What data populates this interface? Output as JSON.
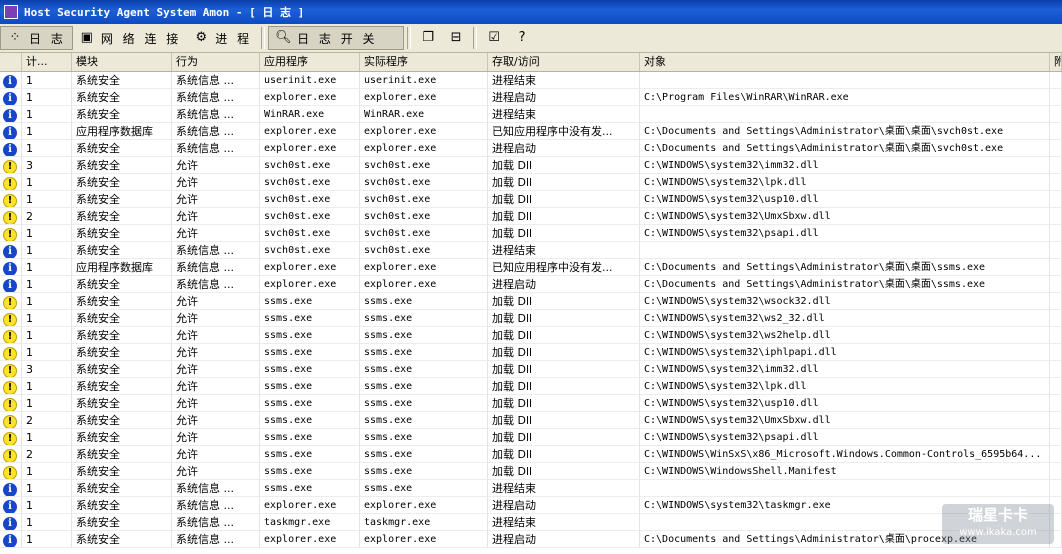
{
  "window": {
    "title": "Host Security Agent System Amon - [ 日 志 ]"
  },
  "toolbar": {
    "log_label": "日 志",
    "network_label": "网 络 连 接",
    "process_label": "进 程",
    "log_switch_label": "日 志 开 关"
  },
  "columns": [
    "计...",
    "模块",
    "行为",
    "应用程序",
    "实际程序",
    "存取/访问",
    "对象",
    "附"
  ],
  "rows": [
    {
      "icon": "info",
      "count": "1",
      "module": "系统安全",
      "action": "系统信息 ...",
      "app": "userinit.exe",
      "real": "userinit.exe",
      "access": "进程结束",
      "object": ""
    },
    {
      "icon": "info",
      "count": "1",
      "module": "系统安全",
      "action": "系统信息 ...",
      "app": "explorer.exe",
      "real": "explorer.exe",
      "access": "进程启动",
      "object": "C:\\Program Files\\WinRAR\\WinRAR.exe"
    },
    {
      "icon": "info",
      "count": "1",
      "module": "系统安全",
      "action": "系统信息 ...",
      "app": "WinRAR.exe",
      "real": "WinRAR.exe",
      "access": "进程结束",
      "object": ""
    },
    {
      "icon": "info",
      "count": "1",
      "module": "应用程序数据库",
      "action": "系统信息 ...",
      "app": "explorer.exe",
      "real": "explorer.exe",
      "access": "已知应用程序中没有发...",
      "object": "C:\\Documents and Settings\\Administrator\\桌面\\桌面\\svch0st.exe"
    },
    {
      "icon": "info",
      "count": "1",
      "module": "系统安全",
      "action": "系统信息 ...",
      "app": "explorer.exe",
      "real": "explorer.exe",
      "access": "进程启动",
      "object": "C:\\Documents and Settings\\Administrator\\桌面\\桌面\\svch0st.exe"
    },
    {
      "icon": "warn",
      "count": "3",
      "module": "系统安全",
      "action": "允许",
      "app": "svch0st.exe",
      "real": "svch0st.exe",
      "access": "加载 Dll",
      "object": "C:\\WINDOWS\\system32\\imm32.dll"
    },
    {
      "icon": "warn",
      "count": "1",
      "module": "系统安全",
      "action": "允许",
      "app": "svch0st.exe",
      "real": "svch0st.exe",
      "access": "加载 Dll",
      "object": "C:\\WINDOWS\\system32\\lpk.dll"
    },
    {
      "icon": "warn",
      "count": "1",
      "module": "系统安全",
      "action": "允许",
      "app": "svch0st.exe",
      "real": "svch0st.exe",
      "access": "加载 Dll",
      "object": "C:\\WINDOWS\\system32\\usp10.dll"
    },
    {
      "icon": "warn",
      "count": "2",
      "module": "系统安全",
      "action": "允许",
      "app": "svch0st.exe",
      "real": "svch0st.exe",
      "access": "加载 Dll",
      "object": "C:\\WINDOWS\\system32\\UmxSbxw.dll"
    },
    {
      "icon": "warn",
      "count": "1",
      "module": "系统安全",
      "action": "允许",
      "app": "svch0st.exe",
      "real": "svch0st.exe",
      "access": "加载 Dll",
      "object": "C:\\WINDOWS\\system32\\psapi.dll"
    },
    {
      "icon": "info",
      "count": "1",
      "module": "系统安全",
      "action": "系统信息 ...",
      "app": "svch0st.exe",
      "real": "svch0st.exe",
      "access": "进程结束",
      "object": ""
    },
    {
      "icon": "info",
      "count": "1",
      "module": "应用程序数据库",
      "action": "系统信息 ...",
      "app": "explorer.exe",
      "real": "explorer.exe",
      "access": "已知应用程序中没有发...",
      "object": "C:\\Documents and Settings\\Administrator\\桌面\\桌面\\ssms.exe"
    },
    {
      "icon": "info",
      "count": "1",
      "module": "系统安全",
      "action": "系统信息 ...",
      "app": "explorer.exe",
      "real": "explorer.exe",
      "access": "进程启动",
      "object": "C:\\Documents and Settings\\Administrator\\桌面\\桌面\\ssms.exe"
    },
    {
      "icon": "warn",
      "count": "1",
      "module": "系统安全",
      "action": "允许",
      "app": "ssms.exe",
      "real": "ssms.exe",
      "access": "加载 Dll",
      "object": "C:\\WINDOWS\\system32\\wsock32.dll"
    },
    {
      "icon": "warn",
      "count": "1",
      "module": "系统安全",
      "action": "允许",
      "app": "ssms.exe",
      "real": "ssms.exe",
      "access": "加载 Dll",
      "object": "C:\\WINDOWS\\system32\\ws2_32.dll"
    },
    {
      "icon": "warn",
      "count": "1",
      "module": "系统安全",
      "action": "允许",
      "app": "ssms.exe",
      "real": "ssms.exe",
      "access": "加载 Dll",
      "object": "C:\\WINDOWS\\system32\\ws2help.dll"
    },
    {
      "icon": "warn",
      "count": "1",
      "module": "系统安全",
      "action": "允许",
      "app": "ssms.exe",
      "real": "ssms.exe",
      "access": "加载 Dll",
      "object": "C:\\WINDOWS\\system32\\iphlpapi.dll"
    },
    {
      "icon": "warn",
      "count": "3",
      "module": "系统安全",
      "action": "允许",
      "app": "ssms.exe",
      "real": "ssms.exe",
      "access": "加载 Dll",
      "object": "C:\\WINDOWS\\system32\\imm32.dll"
    },
    {
      "icon": "warn",
      "count": "1",
      "module": "系统安全",
      "action": "允许",
      "app": "ssms.exe",
      "real": "ssms.exe",
      "access": "加载 Dll",
      "object": "C:\\WINDOWS\\system32\\lpk.dll"
    },
    {
      "icon": "warn",
      "count": "1",
      "module": "系统安全",
      "action": "允许",
      "app": "ssms.exe",
      "real": "ssms.exe",
      "access": "加载 Dll",
      "object": "C:\\WINDOWS\\system32\\usp10.dll"
    },
    {
      "icon": "warn",
      "count": "2",
      "module": "系统安全",
      "action": "允许",
      "app": "ssms.exe",
      "real": "ssms.exe",
      "access": "加载 Dll",
      "object": "C:\\WINDOWS\\system32\\UmxSbxw.dll"
    },
    {
      "icon": "warn",
      "count": "1",
      "module": "系统安全",
      "action": "允许",
      "app": "ssms.exe",
      "real": "ssms.exe",
      "access": "加载 Dll",
      "object": "C:\\WINDOWS\\system32\\psapi.dll"
    },
    {
      "icon": "warn",
      "count": "2",
      "module": "系统安全",
      "action": "允许",
      "app": "ssms.exe",
      "real": "ssms.exe",
      "access": "加载 Dll",
      "object": "C:\\WINDOWS\\WinSxS\\x86_Microsoft.Windows.Common-Controls_6595b64..."
    },
    {
      "icon": "warn",
      "count": "1",
      "module": "系统安全",
      "action": "允许",
      "app": "ssms.exe",
      "real": "ssms.exe",
      "access": "加载 Dll",
      "object": "C:\\WINDOWS\\WindowsShell.Manifest"
    },
    {
      "icon": "info",
      "count": "1",
      "module": "系统安全",
      "action": "系统信息 ...",
      "app": "ssms.exe",
      "real": "ssms.exe",
      "access": "进程结束",
      "object": ""
    },
    {
      "icon": "info",
      "count": "1",
      "module": "系统安全",
      "action": "系统信息 ...",
      "app": "explorer.exe",
      "real": "explorer.exe",
      "access": "进程启动",
      "object": "C:\\WINDOWS\\system32\\taskmgr.exe"
    },
    {
      "icon": "info",
      "count": "1",
      "module": "系统安全",
      "action": "系统信息 ...",
      "app": "taskmgr.exe",
      "real": "taskmgr.exe",
      "access": "进程结束",
      "object": ""
    },
    {
      "icon": "info",
      "count": "1",
      "module": "系统安全",
      "action": "系统信息 ...",
      "app": "explorer.exe",
      "real": "explorer.exe",
      "access": "进程启动",
      "object": "C:\\Documents and Settings\\Administrator\\桌面\\procexp.exe"
    }
  ],
  "watermark": {
    "line1": "瑞星卡卡",
    "line2": "www.ikaka.com"
  },
  "colors": {
    "titlebar": "#0a3fa8",
    "info": "#1746c9",
    "warn": "#ffe22b",
    "toolbar": "#ece9d8"
  }
}
